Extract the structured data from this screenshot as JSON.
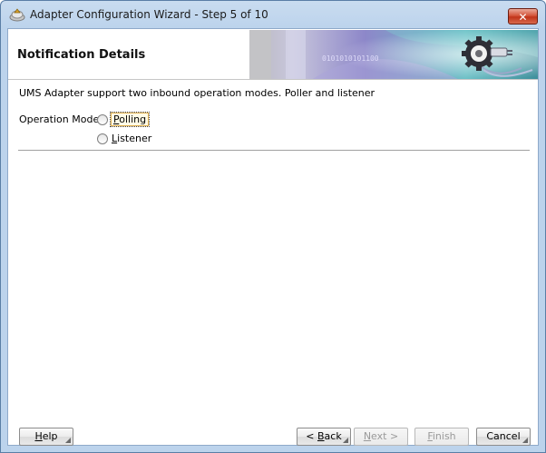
{
  "window": {
    "title": "Adapter Configuration Wizard - Step 5 of 10",
    "close_glyph": "✕",
    "app_icon": "adapter-wizard-icon"
  },
  "header": {
    "title": "Notification Details",
    "banner_text": "0101010101100",
    "banner_icon": "gear-plug-icon"
  },
  "content": {
    "description": "UMS Adapter support two inbound operation modes. Poller and listener",
    "operation_mode_label": "Operation Mode:",
    "options": [
      {
        "label": "Polling",
        "mnemonic": "P",
        "selected": false,
        "focused": true
      },
      {
        "label": "Listener",
        "mnemonic": "L",
        "selected": false,
        "focused": false
      }
    ]
  },
  "buttons": {
    "help": {
      "label": "Help",
      "enabled": true
    },
    "back": {
      "label": "< Back",
      "enabled": true
    },
    "next": {
      "label": "Next >",
      "enabled": false
    },
    "finish": {
      "label": "Finish",
      "enabled": false
    },
    "cancel": {
      "label": "Cancel",
      "enabled": true
    }
  },
  "colors": {
    "titlebar": "#bcd3ec",
    "close_button": "#c0341a",
    "banner_purple": "#8d87c9",
    "banner_teal": "#3e8f9c"
  }
}
